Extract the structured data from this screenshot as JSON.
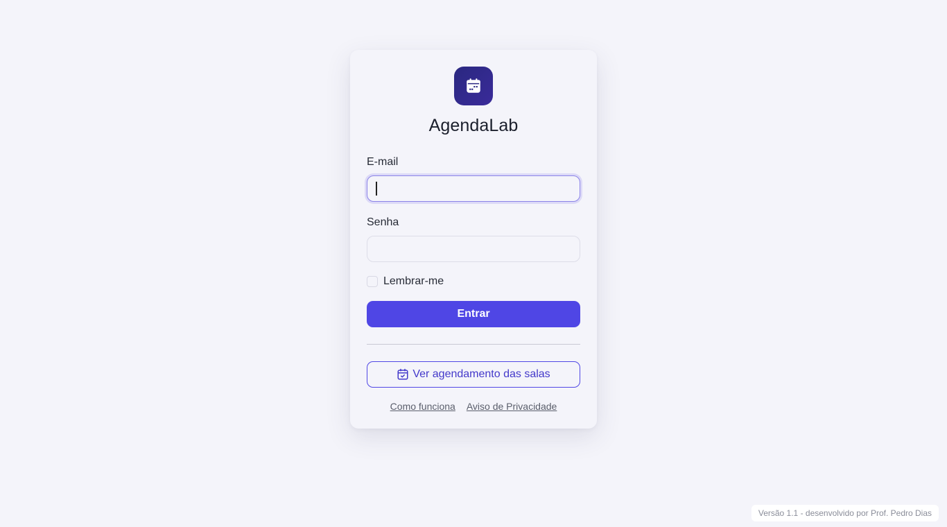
{
  "app": {
    "title": "AgendaLab",
    "logo_icon": "calendar-icon",
    "logo_color": "#2a2880"
  },
  "form": {
    "email_label": "E-mail",
    "email_value": "",
    "password_label": "Senha",
    "password_value": "",
    "remember_label": "Lembrar-me",
    "remember_checked": false,
    "submit_label": "Entrar",
    "accent_color": "#4f46e5"
  },
  "schedule_button": {
    "label": "Ver agendamento das salas",
    "icon": "calendar-check-icon"
  },
  "links": {
    "how_it_works": "Como funciona",
    "privacy": "Aviso de Privacidade"
  },
  "footer": {
    "text": "Versão 1.1 - desenvolvido por Prof. Pedro Dias"
  }
}
